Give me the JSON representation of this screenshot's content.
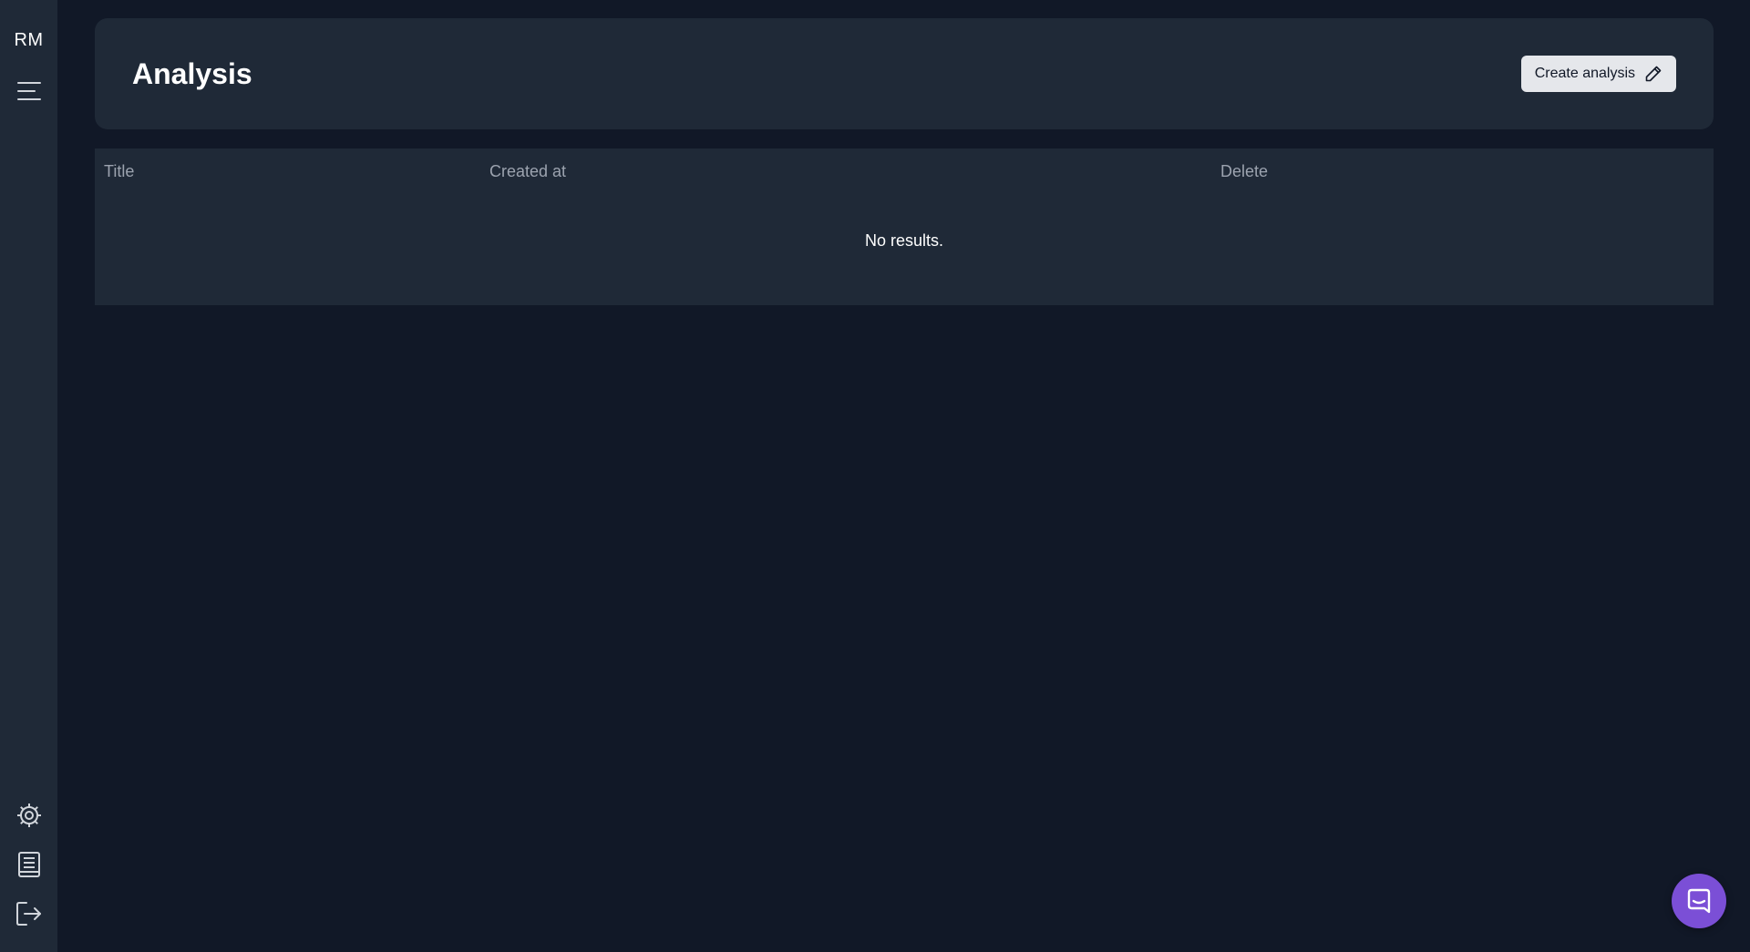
{
  "sidebar": {
    "user_initials": "RM",
    "icons": {
      "menu": "menu-icon",
      "settings": "gear-icon",
      "docs": "book-icon",
      "logout": "logout-icon"
    }
  },
  "header": {
    "title": "Analysis",
    "create_label": "Create analysis",
    "create_icon": "pencil-icon"
  },
  "table": {
    "columns": [
      "Title",
      "Created at",
      "Delete"
    ],
    "empty_message": "No results."
  },
  "chat": {
    "icon": "chat-icon",
    "color": "#7b4fd6"
  },
  "colors": {
    "background": "#111827",
    "panel": "#1f2937",
    "button_bg": "#e5e7eb",
    "muted_text": "#9ca3af"
  }
}
